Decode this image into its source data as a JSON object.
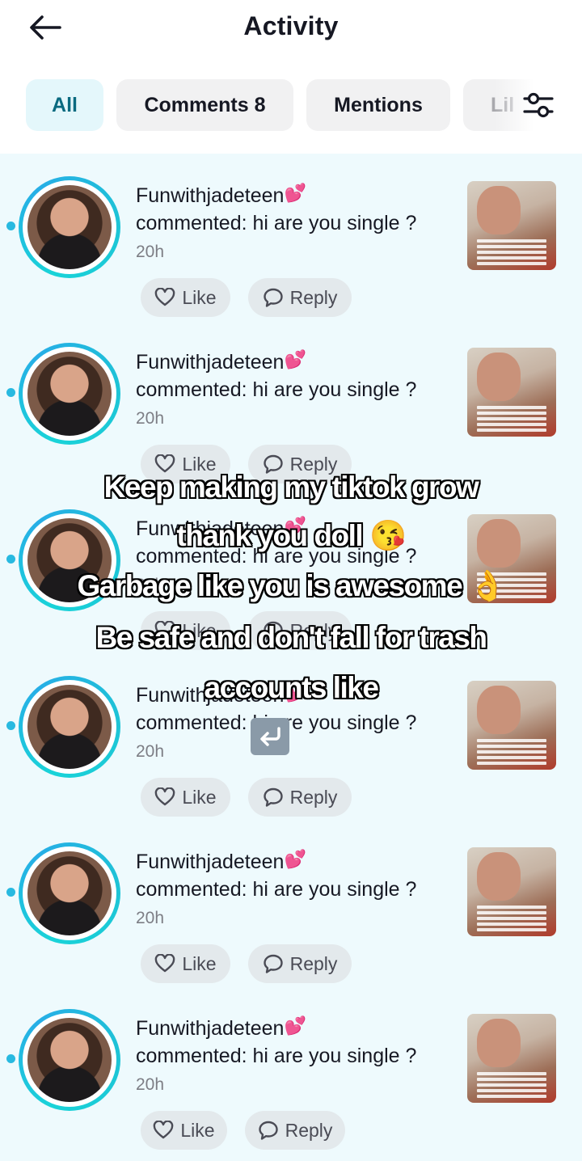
{
  "header": {
    "title": "Activity",
    "back_icon": "arrow-left-icon"
  },
  "tabs": [
    {
      "label": "All",
      "active": true
    },
    {
      "label": "Comments 8",
      "active": false
    },
    {
      "label": "Mentions",
      "active": false
    },
    {
      "label": "Lil",
      "active": false
    }
  ],
  "filter_icon": "sliders-icon",
  "colors": {
    "accent": "#28b9e0",
    "list_bg": "#eefafd",
    "active_tab_bg": "#e4f7fb",
    "active_tab_text": "#0a6a80"
  },
  "items": [
    {
      "username": "Funwithjadeteen",
      "emoji": "💕",
      "comment": "commented: hi are you single ?",
      "time": "20h",
      "like_label": "Like",
      "reply_label": "Reply"
    },
    {
      "username": "Funwithjadeteen",
      "emoji": "💕",
      "comment": "commented: hi are you single ?",
      "time": "20h",
      "like_label": "Like",
      "reply_label": "Reply"
    },
    {
      "username": "Funwithjadeteen",
      "emoji": "💕",
      "comment": "commented: hi are you single ?",
      "time": "20h",
      "like_label": "Like",
      "reply_label": "Reply"
    },
    {
      "username": "Funwithjadeteen",
      "emoji": "💕",
      "comment": "commented: hi are you single ?",
      "time": "20h",
      "like_label": "Like",
      "reply_label": "Reply"
    },
    {
      "username": "Funwithjadeteen",
      "emoji": "💕",
      "comment": "commented: hi are you single ?",
      "time": "20h",
      "like_label": "Like",
      "reply_label": "Reply"
    },
    {
      "username": "Funwithjadeteen",
      "emoji": "💕",
      "comment": "commented: hi are you single ?",
      "time": "20h",
      "like_label": "Like",
      "reply_label": "Reply"
    }
  ],
  "overlay": {
    "line1": "Keep making my tiktok grow",
    "line2": "thank you doll",
    "line2_emoji": "😘",
    "line3": "Garbage like you is awesome",
    "line3_emoji": "👌",
    "line4": "Be safe and don't fall for trash",
    "line5": "accounts like",
    "return_icon": "return-arrow-icon"
  }
}
